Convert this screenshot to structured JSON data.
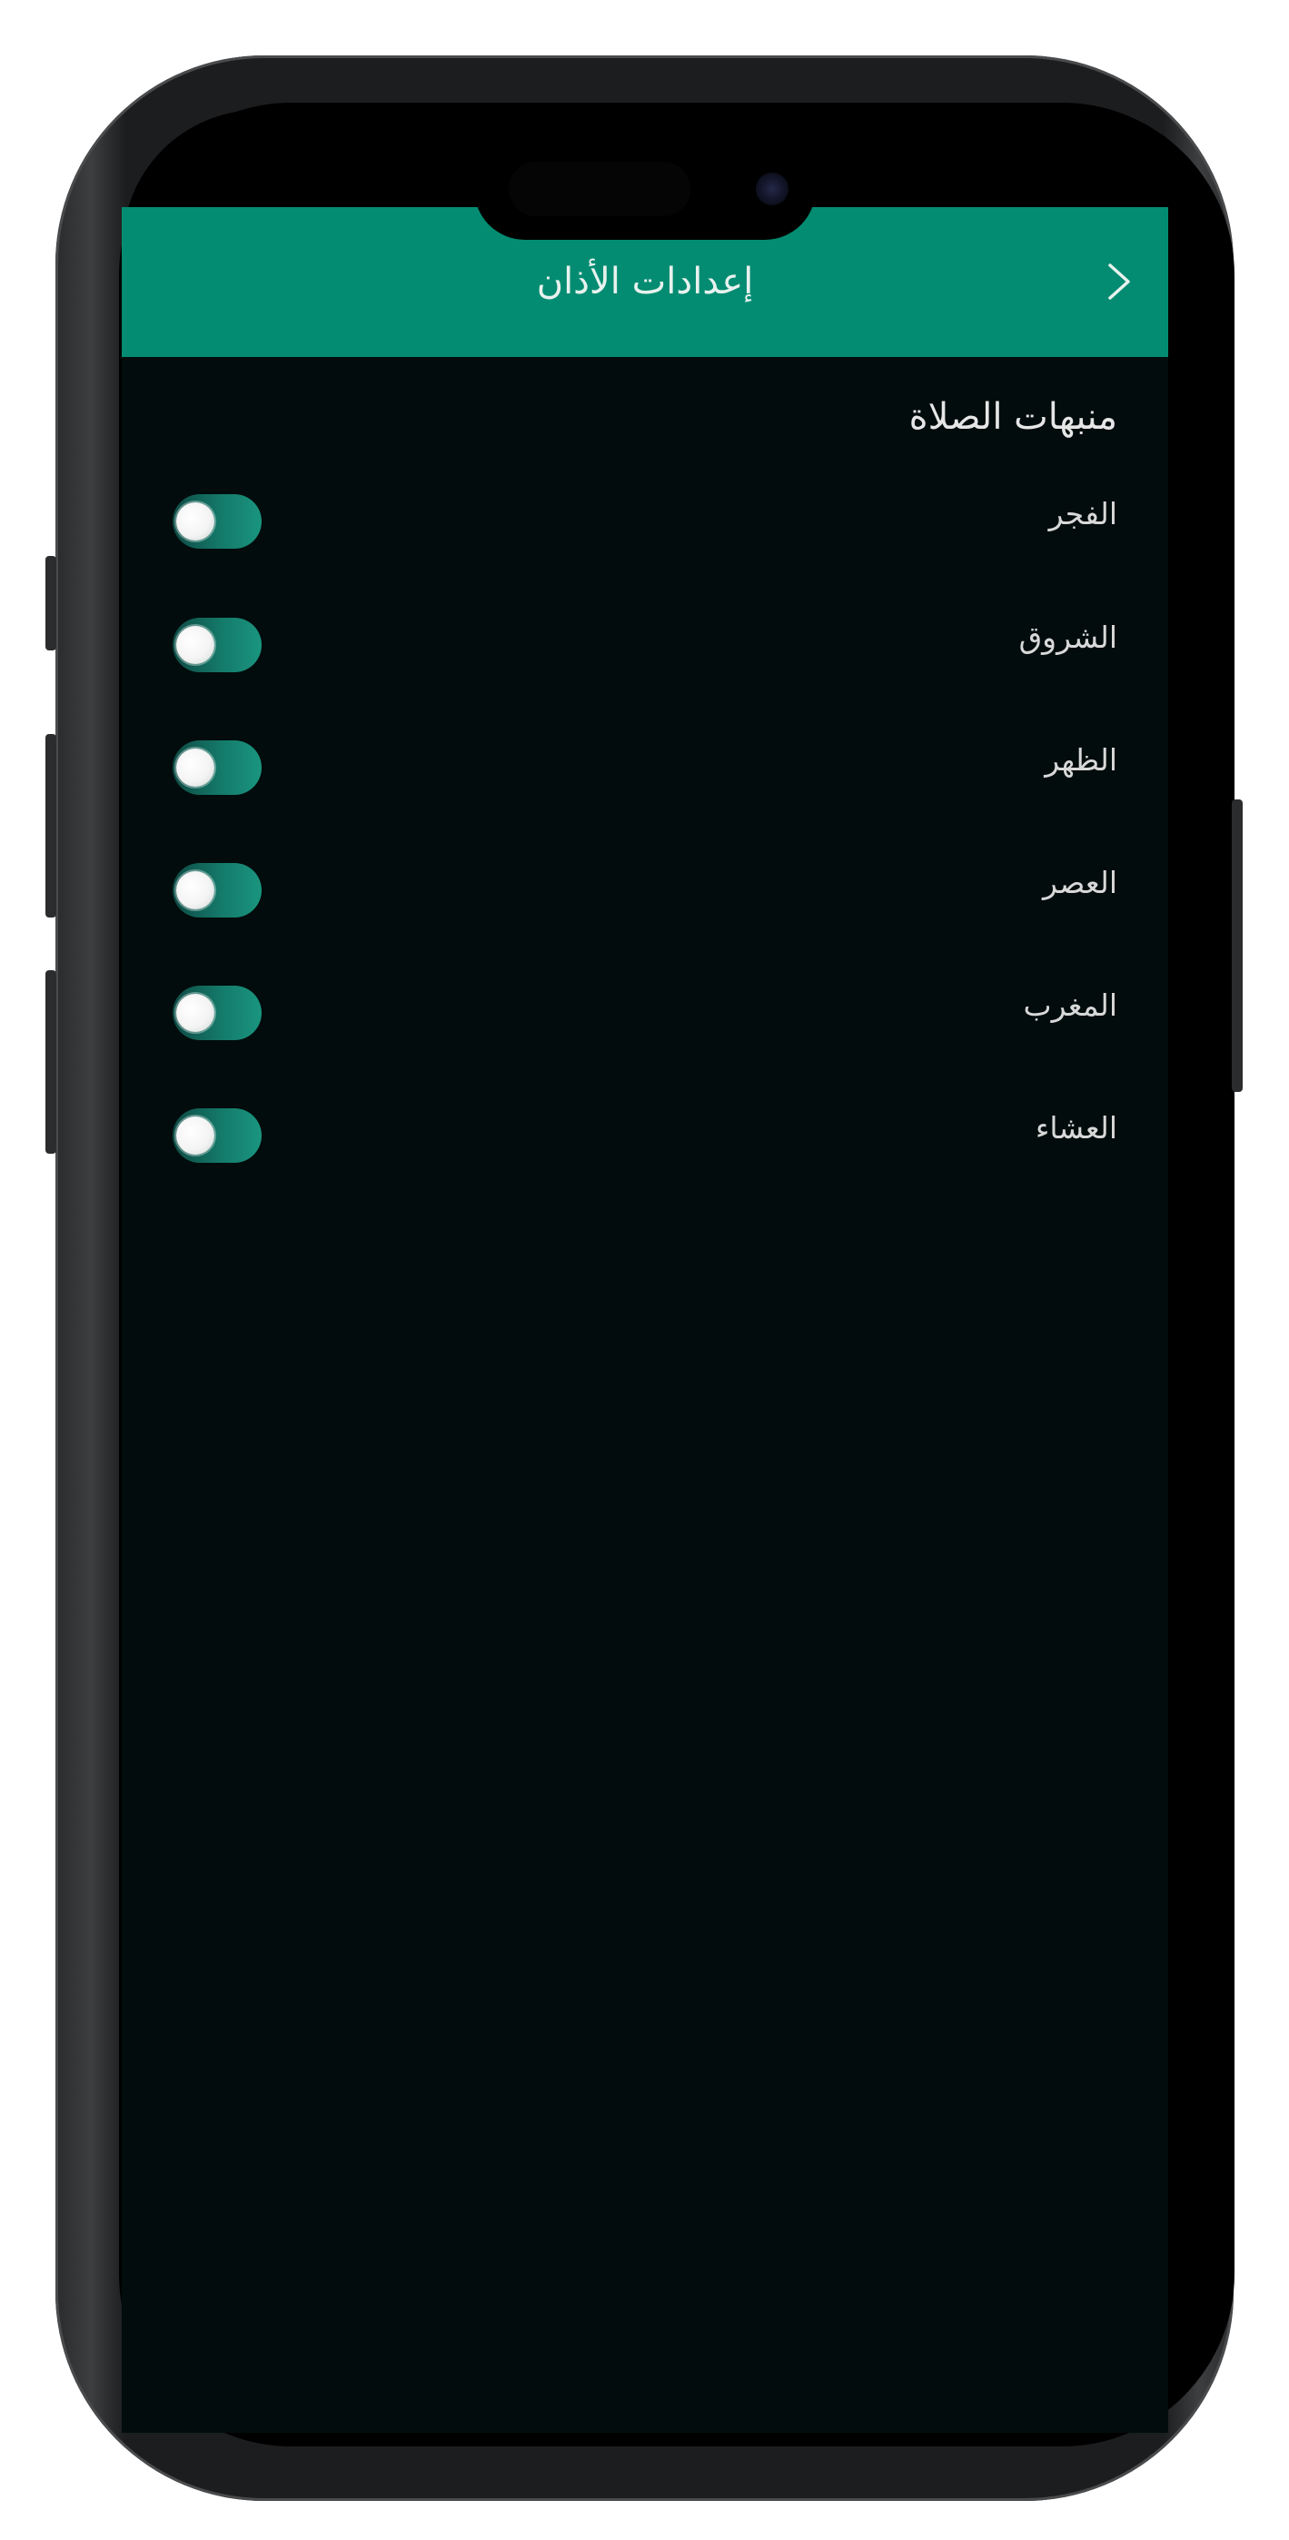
{
  "header": {
    "title": "إعدادات الأذان",
    "back_icon": "chevron-right-icon",
    "background": "#048c72"
  },
  "section": {
    "title": "منبهات الصلاة"
  },
  "prayers": [
    {
      "label": "الفجر",
      "enabled": false
    },
    {
      "label": "الشروق",
      "enabled": false
    },
    {
      "label": "الظهر",
      "enabled": false
    },
    {
      "label": "العصر",
      "enabled": false
    },
    {
      "label": "المغرب",
      "enabled": false
    },
    {
      "label": "العشاء",
      "enabled": false
    }
  ],
  "colors": {
    "accent": "#048c72",
    "background": "#020c0c",
    "toggle_track": "#147a6a"
  }
}
